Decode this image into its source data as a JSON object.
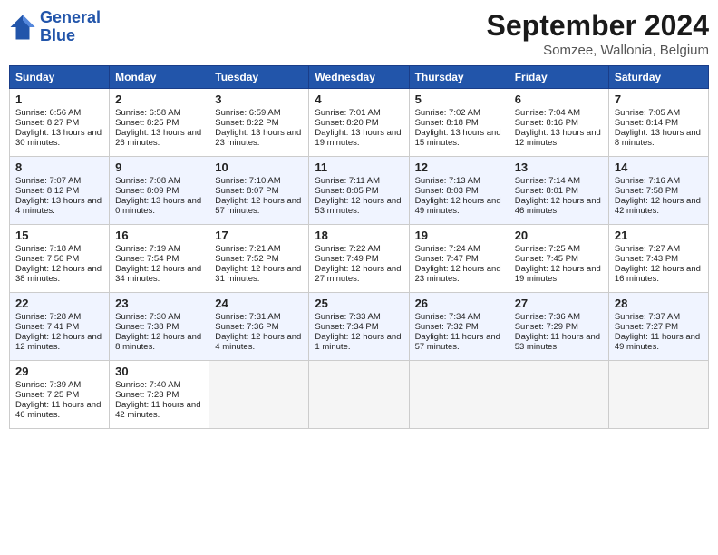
{
  "header": {
    "logo_line1": "General",
    "logo_line2": "Blue",
    "month": "September 2024",
    "location": "Somzee, Wallonia, Belgium"
  },
  "days_header": [
    "Sunday",
    "Monday",
    "Tuesday",
    "Wednesday",
    "Thursday",
    "Friday",
    "Saturday"
  ],
  "weeks": [
    [
      {
        "day": "1",
        "sunrise": "6:56 AM",
        "sunset": "8:27 PM",
        "daylight": "13 hours and 30 minutes."
      },
      {
        "day": "2",
        "sunrise": "6:58 AM",
        "sunset": "8:25 PM",
        "daylight": "13 hours and 26 minutes."
      },
      {
        "day": "3",
        "sunrise": "6:59 AM",
        "sunset": "8:22 PM",
        "daylight": "13 hours and 23 minutes."
      },
      {
        "day": "4",
        "sunrise": "7:01 AM",
        "sunset": "8:20 PM",
        "daylight": "13 hours and 19 minutes."
      },
      {
        "day": "5",
        "sunrise": "7:02 AM",
        "sunset": "8:18 PM",
        "daylight": "13 hours and 15 minutes."
      },
      {
        "day": "6",
        "sunrise": "7:04 AM",
        "sunset": "8:16 PM",
        "daylight": "13 hours and 12 minutes."
      },
      {
        "day": "7",
        "sunrise": "7:05 AM",
        "sunset": "8:14 PM",
        "daylight": "13 hours and 8 minutes."
      }
    ],
    [
      {
        "day": "8",
        "sunrise": "7:07 AM",
        "sunset": "8:12 PM",
        "daylight": "13 hours and 4 minutes."
      },
      {
        "day": "9",
        "sunrise": "7:08 AM",
        "sunset": "8:09 PM",
        "daylight": "13 hours and 0 minutes."
      },
      {
        "day": "10",
        "sunrise": "7:10 AM",
        "sunset": "8:07 PM",
        "daylight": "12 hours and 57 minutes."
      },
      {
        "day": "11",
        "sunrise": "7:11 AM",
        "sunset": "8:05 PM",
        "daylight": "12 hours and 53 minutes."
      },
      {
        "day": "12",
        "sunrise": "7:13 AM",
        "sunset": "8:03 PM",
        "daylight": "12 hours and 49 minutes."
      },
      {
        "day": "13",
        "sunrise": "7:14 AM",
        "sunset": "8:01 PM",
        "daylight": "12 hours and 46 minutes."
      },
      {
        "day": "14",
        "sunrise": "7:16 AM",
        "sunset": "7:58 PM",
        "daylight": "12 hours and 42 minutes."
      }
    ],
    [
      {
        "day": "15",
        "sunrise": "7:18 AM",
        "sunset": "7:56 PM",
        "daylight": "12 hours and 38 minutes."
      },
      {
        "day": "16",
        "sunrise": "7:19 AM",
        "sunset": "7:54 PM",
        "daylight": "12 hours and 34 minutes."
      },
      {
        "day": "17",
        "sunrise": "7:21 AM",
        "sunset": "7:52 PM",
        "daylight": "12 hours and 31 minutes."
      },
      {
        "day": "18",
        "sunrise": "7:22 AM",
        "sunset": "7:49 PM",
        "daylight": "12 hours and 27 minutes."
      },
      {
        "day": "19",
        "sunrise": "7:24 AM",
        "sunset": "7:47 PM",
        "daylight": "12 hours and 23 minutes."
      },
      {
        "day": "20",
        "sunrise": "7:25 AM",
        "sunset": "7:45 PM",
        "daylight": "12 hours and 19 minutes."
      },
      {
        "day": "21",
        "sunrise": "7:27 AM",
        "sunset": "7:43 PM",
        "daylight": "12 hours and 16 minutes."
      }
    ],
    [
      {
        "day": "22",
        "sunrise": "7:28 AM",
        "sunset": "7:41 PM",
        "daylight": "12 hours and 12 minutes."
      },
      {
        "day": "23",
        "sunrise": "7:30 AM",
        "sunset": "7:38 PM",
        "daylight": "12 hours and 8 minutes."
      },
      {
        "day": "24",
        "sunrise": "7:31 AM",
        "sunset": "7:36 PM",
        "daylight": "12 hours and 4 minutes."
      },
      {
        "day": "25",
        "sunrise": "7:33 AM",
        "sunset": "7:34 PM",
        "daylight": "12 hours and 1 minute."
      },
      {
        "day": "26",
        "sunrise": "7:34 AM",
        "sunset": "7:32 PM",
        "daylight": "11 hours and 57 minutes."
      },
      {
        "day": "27",
        "sunrise": "7:36 AM",
        "sunset": "7:29 PM",
        "daylight": "11 hours and 53 minutes."
      },
      {
        "day": "28",
        "sunrise": "7:37 AM",
        "sunset": "7:27 PM",
        "daylight": "11 hours and 49 minutes."
      }
    ],
    [
      {
        "day": "29",
        "sunrise": "7:39 AM",
        "sunset": "7:25 PM",
        "daylight": "11 hours and 46 minutes."
      },
      {
        "day": "30",
        "sunrise": "7:40 AM",
        "sunset": "7:23 PM",
        "daylight": "11 hours and 42 minutes."
      },
      null,
      null,
      null,
      null,
      null
    ]
  ]
}
